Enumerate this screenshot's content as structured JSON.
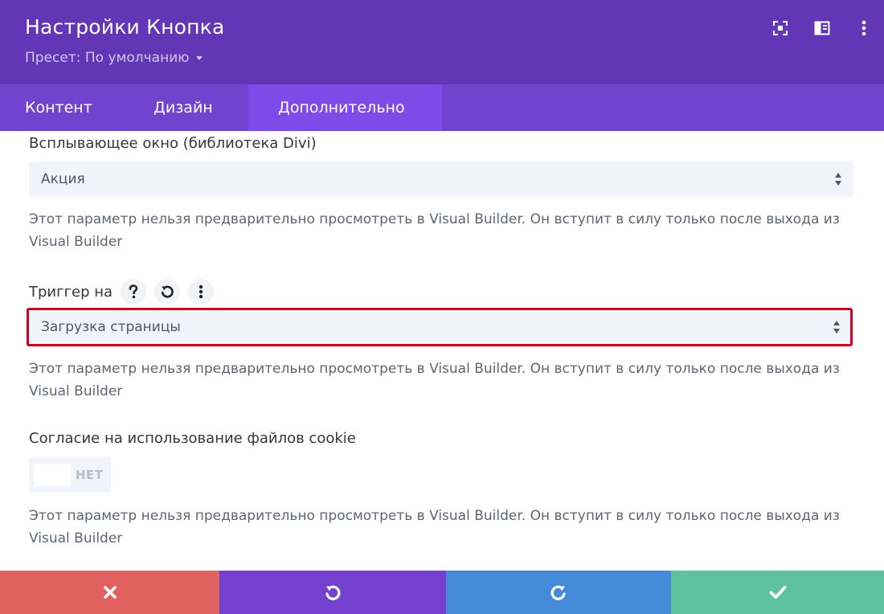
{
  "header": {
    "title": "Настройки Кнопка",
    "preset": "Пресет: По умолчанию",
    "icons": [
      "focus-icon",
      "split-view-icon",
      "more-vertical-icon"
    ]
  },
  "tabs": [
    {
      "label": "Контент"
    },
    {
      "label": "Дизайн"
    },
    {
      "label": "Дополнительно",
      "active": true
    }
  ],
  "fields": {
    "popup": {
      "label": "Всплывающее окно (библиотека Divi)",
      "value": "Акция",
      "help": "Этот параметр нельзя предварительно просмотреть в Visual Builder. Он вступит в силу только после выхода из Visual Builder"
    },
    "trigger": {
      "label": "Триггер на",
      "value": "Загрузка страницы",
      "help": "Этот параметр нельзя предварительно просмотреть в Visual Builder. Он вступит в силу только после выхода из Visual Builder"
    },
    "cookie": {
      "label": "Согласие на использование файлов cookie",
      "toggle": "НЕТ",
      "help": "Этот параметр нельзя предварительно просмотреть в Visual Builder. Он вступит в силу только после выхода из Visual Builder"
    }
  },
  "colors": {
    "header": "#6236b4",
    "tabs": "#7243cf",
    "active_tab": "#7f4be8",
    "highlight": "#d0021b",
    "cancel": "#e16161",
    "undo": "#7440d0",
    "redo": "#4589d9",
    "save": "#5ec19f"
  }
}
